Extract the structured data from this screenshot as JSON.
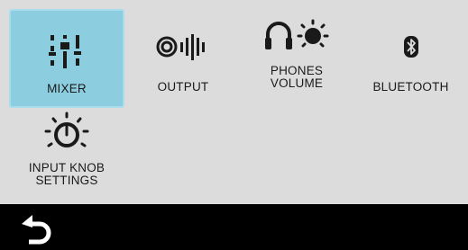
{
  "menu": {
    "tiles": [
      {
        "label": "MIXER",
        "icon": "mixer-faders-icon",
        "selected": true
      },
      {
        "label": "OUTPUT",
        "icon": "output-speaker-icon",
        "selected": false
      },
      {
        "label": "PHONES\nVOLUME",
        "icon": "headphones-volume-icon",
        "selected": false
      },
      {
        "label": "BLUETOOTH",
        "icon": "bluetooth-icon",
        "selected": false
      },
      {
        "label": "INPUT KNOB\nSETTINGS",
        "icon": "knob-icon",
        "selected": false
      }
    ]
  },
  "footer": {
    "back_icon": "back-arrow-icon"
  },
  "colors": {
    "panel_background": "#dcdcdc",
    "selected_background": "#8ccde0",
    "selected_border": "#a8ddee",
    "footer_background": "#000000",
    "text": "#1a1a1a"
  }
}
